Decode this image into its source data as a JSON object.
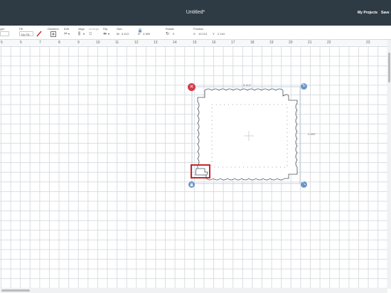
{
  "header": {
    "title": "Untitled*",
    "my_projects": "My Projects",
    "save": "Save"
  },
  "toolbar": {
    "type_label": "ype",
    "fill_label": "Fill",
    "fill_value": "No Fill",
    "deselect_label": "Deselect",
    "edit_label": "Edit",
    "align_label": "Align",
    "arrange_label": "Arrange",
    "flip_label": "Flip",
    "size_label": "Size",
    "size_w_prefix": "W",
    "size_w": "5.413",
    "size_h_prefix": "H",
    "size_h": "4.389",
    "rotate_label": "Rotate",
    "rotate_value": "0",
    "position_label": "Position",
    "position_x_prefix": "X",
    "position_x": "10.213",
    "position_y_prefix": "Y",
    "position_y": "2.194"
  },
  "ruler": {
    "numbers": [
      "5",
      "6",
      "7",
      "8",
      "9",
      "10",
      "11",
      "12",
      "13",
      "14",
      "15",
      "16",
      "17",
      "18",
      "19",
      "20",
      "21",
      "22",
      "23"
    ]
  },
  "selection": {
    "width_label": "5.413\"",
    "height_label": "4.389\""
  },
  "icons": {
    "delete": "close-icon",
    "rotate": "rotate-icon",
    "lock": "lock-icon",
    "scale": "resize-icon"
  },
  "colors": {
    "topbar": "#2f3b44",
    "delete_button": "#d43a48",
    "handle_button": "#6a93c7",
    "highlight": "#c4262e"
  }
}
